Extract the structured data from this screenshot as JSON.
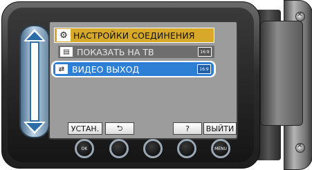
{
  "menu": {
    "title": "НАСТРОЙКИ СОЕДИНЕНИЯ",
    "title_icon": "settings-icon",
    "items": [
      {
        "label": "ПОКАЗАТЬ НА ТВ",
        "icon": "tv-display-icon",
        "badge": "16:9",
        "selected": false
      },
      {
        "label": "ВИДЕО ВЫХОД",
        "icon": "video-output-icon",
        "badge": "16:9",
        "selected": true
      }
    ]
  },
  "softkeys": {
    "set": "УСТАН.",
    "back": "⮌",
    "help": "?",
    "exit": "ВЫЙТИ"
  },
  "hardware": {
    "ok_label": "OK",
    "menu_label": "MENU"
  },
  "colors": {
    "selection": "#2d7fd6",
    "title_bar": "#d8a828",
    "screen_bg": "#9c9c9c"
  }
}
